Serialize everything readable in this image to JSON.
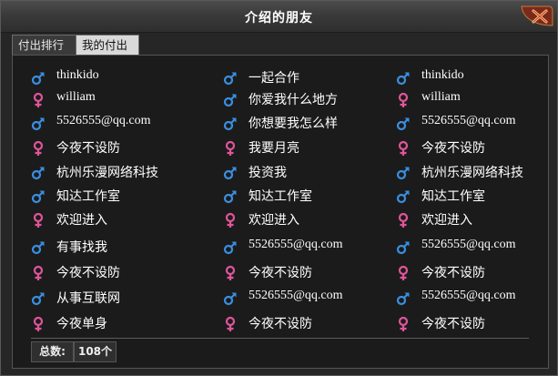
{
  "window": {
    "title": "介绍的朋友"
  },
  "tabs": [
    {
      "label": "付出排行",
      "active": false
    },
    {
      "label": "我的付出",
      "active": true
    }
  ],
  "colors": {
    "male": "#3a8fe0",
    "female": "#e0559a"
  },
  "friends": [
    [
      {
        "gender": "male",
        "name": "thinkido"
      },
      {
        "gender": "male",
        "name": "一起合作"
      },
      {
        "gender": "male",
        "name": "thinkido"
      }
    ],
    [
      {
        "gender": "female",
        "name": "william"
      },
      {
        "gender": "male",
        "name": "你爱我什么地方"
      },
      {
        "gender": "female",
        "name": "william"
      }
    ],
    [
      {
        "gender": "male",
        "name": "5526555@qq.com"
      },
      {
        "gender": "male",
        "name": "你想要我怎么样"
      },
      {
        "gender": "male",
        "name": "5526555@qq.com"
      }
    ],
    [
      {
        "gender": "female",
        "name": "今夜不设防"
      },
      {
        "gender": "female",
        "name": "我要月亮"
      },
      {
        "gender": "female",
        "name": "今夜不设防"
      }
    ],
    [
      {
        "gender": "male",
        "name": "杭州乐漫网络科技"
      },
      {
        "gender": "male",
        "name": "投资我"
      },
      {
        "gender": "male",
        "name": "杭州乐漫网络科技"
      }
    ],
    [
      {
        "gender": "male",
        "name": "知达工作室"
      },
      {
        "gender": "male",
        "name": "知达工作室"
      },
      {
        "gender": "male",
        "name": "知达工作室"
      }
    ],
    [
      {
        "gender": "female",
        "name": "欢迎进入"
      },
      {
        "gender": "female",
        "name": "欢迎进入"
      },
      {
        "gender": "female",
        "name": "欢迎进入"
      }
    ],
    [
      {
        "gender": "male",
        "name": "有事找我"
      },
      {
        "gender": "male",
        "name": "5526555@qq.com"
      },
      {
        "gender": "male",
        "name": "5526555@qq.com"
      }
    ],
    [
      {
        "gender": "female",
        "name": "今夜不设防"
      },
      {
        "gender": "female",
        "name": "今夜不设防"
      },
      {
        "gender": "female",
        "name": "今夜不设防"
      }
    ],
    [
      {
        "gender": "male",
        "name": "从事互联网"
      },
      {
        "gender": "male",
        "name": "5526555@qq.com"
      },
      {
        "gender": "male",
        "name": "5526555@qq.com"
      }
    ],
    [
      {
        "gender": "female",
        "name": "今夜单身"
      },
      {
        "gender": "female",
        "name": "今夜不设防"
      },
      {
        "gender": "female",
        "name": "今夜不设防"
      }
    ]
  ],
  "footer": {
    "total_label": "总数:",
    "total_value": "108个"
  }
}
